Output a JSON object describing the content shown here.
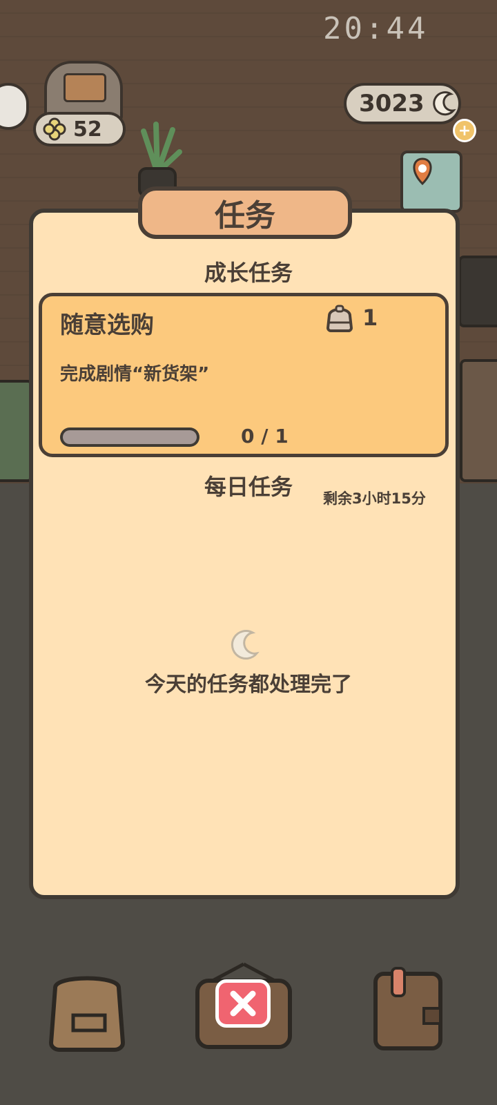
{
  "status_bar": {
    "time": "20:44"
  },
  "hud": {
    "currency_value": "3023",
    "clover_value": "52"
  },
  "panel": {
    "title": "任务",
    "growth_section_title": "成长任务",
    "growth_task": {
      "name": "随意选购",
      "reward_count": "1",
      "description": "完成剧情“新货架”",
      "progress_text": "0 / 1",
      "progress_fraction": 0
    },
    "daily_section_title": "每日任务",
    "daily_remaining": "剩余3小时15分",
    "daily_empty_message": "今天的任务都处理完了"
  },
  "icons": {
    "currency": "moon-icon",
    "clover": "clover-icon",
    "reward": "bag-icon",
    "close": "close-icon",
    "bottom_left": "backpack-icon",
    "bottom_right": "notebook-icon"
  },
  "colors": {
    "panel_bg": "#ffe2b6",
    "card_bg": "#fcc97d",
    "title_board": "#efb788",
    "close_button": "#f06470",
    "text": "#4a3f36"
  }
}
